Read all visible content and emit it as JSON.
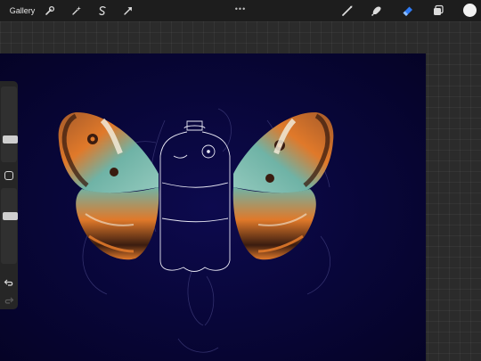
{
  "toolbar": {
    "gallery_label": "Gallery",
    "left_tools": [
      "wrench-icon",
      "magic-wand-icon",
      "selection-icon",
      "transform-arrow-icon"
    ],
    "more_label": "•••",
    "right_tools": [
      "brush-icon",
      "smudge-icon",
      "eraser-icon",
      "layers-icon"
    ],
    "active_tool": "eraser-icon",
    "active_color": "#f2f2f2"
  },
  "sidebar": {
    "brush_size_level": 0.72,
    "opacity_level": 0.35
  },
  "colors": {
    "canvas_bg": "#080638",
    "accent": "#2f7cf6",
    "wing_teal": "#6fb3a6",
    "wing_orange": "#e0792a"
  }
}
